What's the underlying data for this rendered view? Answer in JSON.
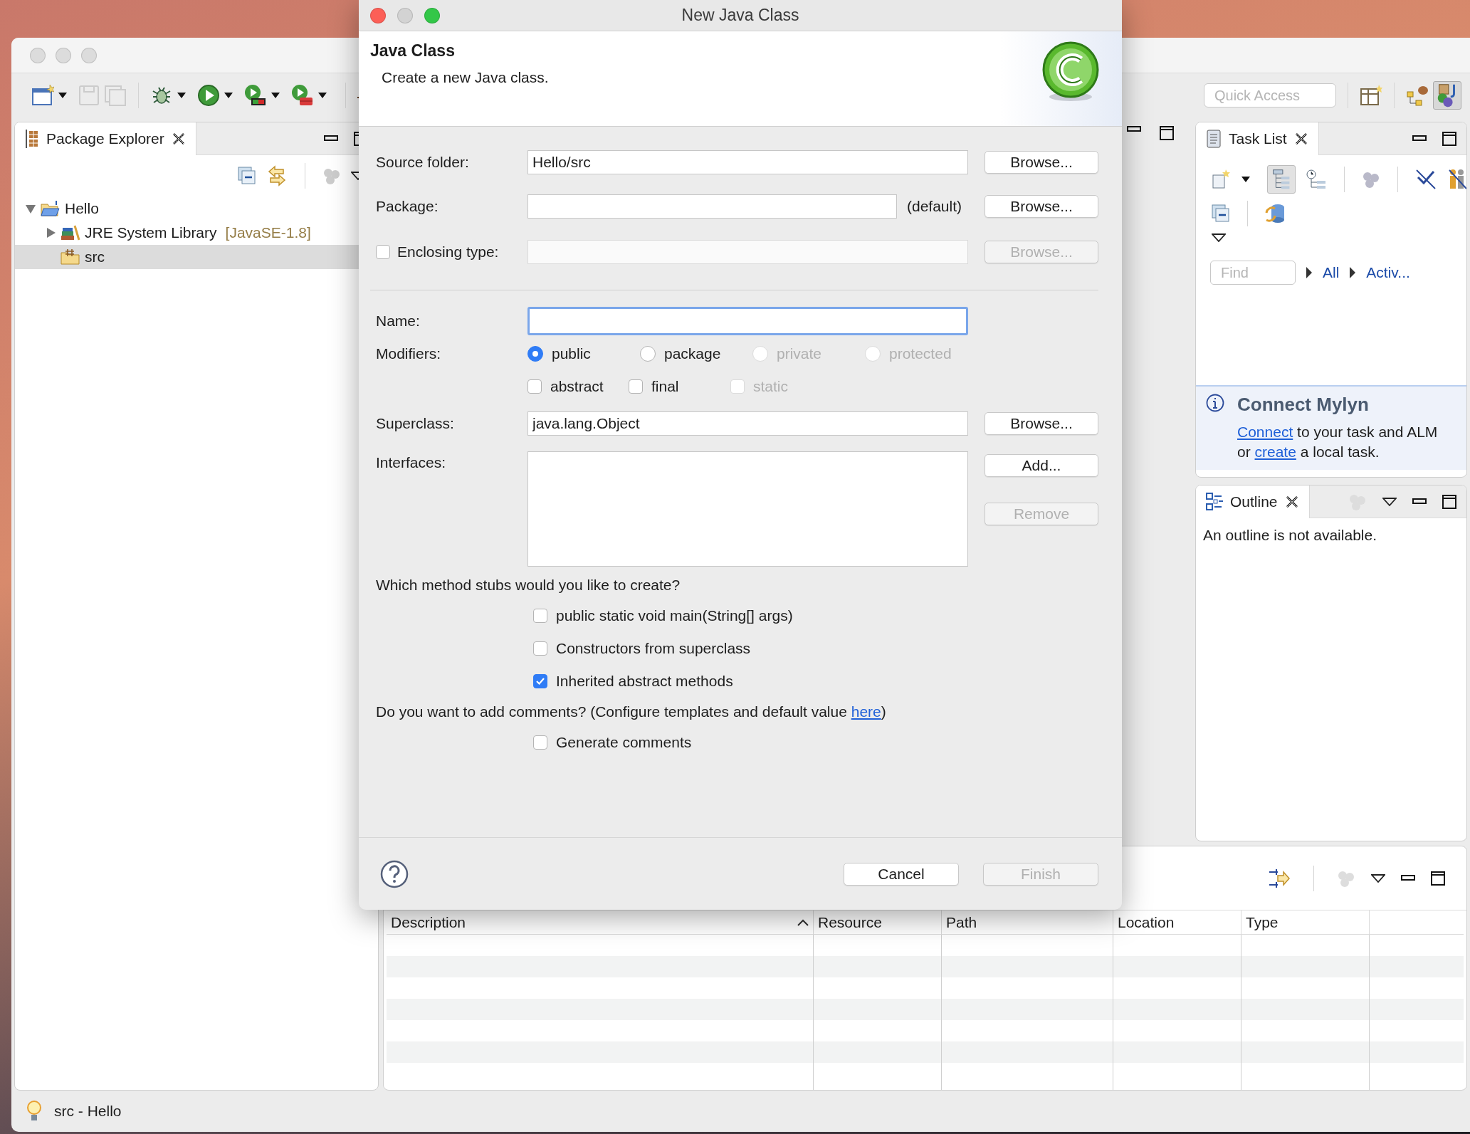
{
  "ide": {
    "quick_access": {
      "placeholder": "Quick Access"
    },
    "package_explorer": {
      "title": "Package Explorer",
      "tree": [
        {
          "label": "Hello",
          "expanded": true,
          "selected": false,
          "children": [
            {
              "label": "JRE System Library",
              "suffix": "[JavaSE-1.8]",
              "expanded": false,
              "selected": false
            },
            {
              "label": "src",
              "selected": true
            }
          ]
        }
      ]
    },
    "task_list": {
      "title": "Task List",
      "find": {
        "placeholder": "Find"
      },
      "filters": [
        "All",
        "Activ..."
      ],
      "notice": {
        "title": "Connect Mylyn",
        "lines": [
          [
            {
              "kind": "link",
              "text": "Connect"
            },
            {
              "kind": "text",
              "text": " to your task and ALM"
            }
          ],
          [
            {
              "kind": "text",
              "text": "or "
            },
            {
              "kind": "link",
              "text": "create"
            },
            {
              "kind": "text",
              "text": " a local task."
            }
          ]
        ]
      }
    },
    "outline": {
      "title": "Outline",
      "message": "An outline is not available."
    },
    "problems": {
      "columns": [
        {
          "label": "Description",
          "sorted": true
        },
        {
          "label": "Resource",
          "sorted": false
        },
        {
          "label": "Path",
          "sorted": false
        },
        {
          "label": "Location",
          "sorted": false
        },
        {
          "label": "Type",
          "sorted": false
        }
      ]
    },
    "status_bar": {
      "text": "src - Hello"
    }
  },
  "dialog": {
    "title": "New Java Class",
    "heading": "Java Class",
    "description": "Create a new Java class.",
    "source_folder": {
      "label": "Source folder:",
      "value": "Hello/src",
      "button": "Browse..."
    },
    "package": {
      "label": "Package:",
      "suffix": "(default)",
      "button": "Browse..."
    },
    "enclosing_type": {
      "label": "Enclosing type:",
      "checked": false,
      "button": "Browse...",
      "disabled": true
    },
    "name": {
      "label": "Name:",
      "focused": true
    },
    "modifiers": {
      "label": "Modifiers:",
      "access": [
        {
          "label": "public",
          "selected": true,
          "disabled": false
        },
        {
          "label": "package",
          "selected": false,
          "disabled": false
        },
        {
          "label": "private",
          "selected": false,
          "disabled": true
        },
        {
          "label": "protected",
          "selected": false,
          "disabled": true
        }
      ],
      "flags": [
        {
          "label": "abstract",
          "checked": false,
          "disabled": false
        },
        {
          "label": "final",
          "checked": false,
          "disabled": false
        },
        {
          "label": "static",
          "checked": false,
          "disabled": true
        }
      ]
    },
    "superclass": {
      "label": "Superclass:",
      "value": "java.lang.Object",
      "button": "Browse..."
    },
    "interfaces": {
      "label": "Interfaces:",
      "buttons": [
        {
          "label": "Add...",
          "disabled": false
        },
        {
          "label": "Remove",
          "disabled": true
        }
      ]
    },
    "stubs": {
      "question": "Which method stubs would you like to create?",
      "options": [
        {
          "label": "public static void main(String[] args)",
          "checked": false
        },
        {
          "label": "Constructors from superclass",
          "checked": false
        },
        {
          "label": "Inherited abstract methods",
          "checked": true
        }
      ]
    },
    "comments": {
      "question": [
        {
          "kind": "text",
          "text": "Do you want to add comments? (Configure templates and default value "
        },
        {
          "kind": "link",
          "text": "here"
        },
        {
          "kind": "text",
          "text": ")"
        }
      ],
      "option": {
        "label": "Generate comments",
        "checked": false
      }
    },
    "footer_buttons": [
      {
        "label": "Cancel",
        "disabled": false
      },
      {
        "label": "Finish",
        "disabled": true
      }
    ]
  }
}
